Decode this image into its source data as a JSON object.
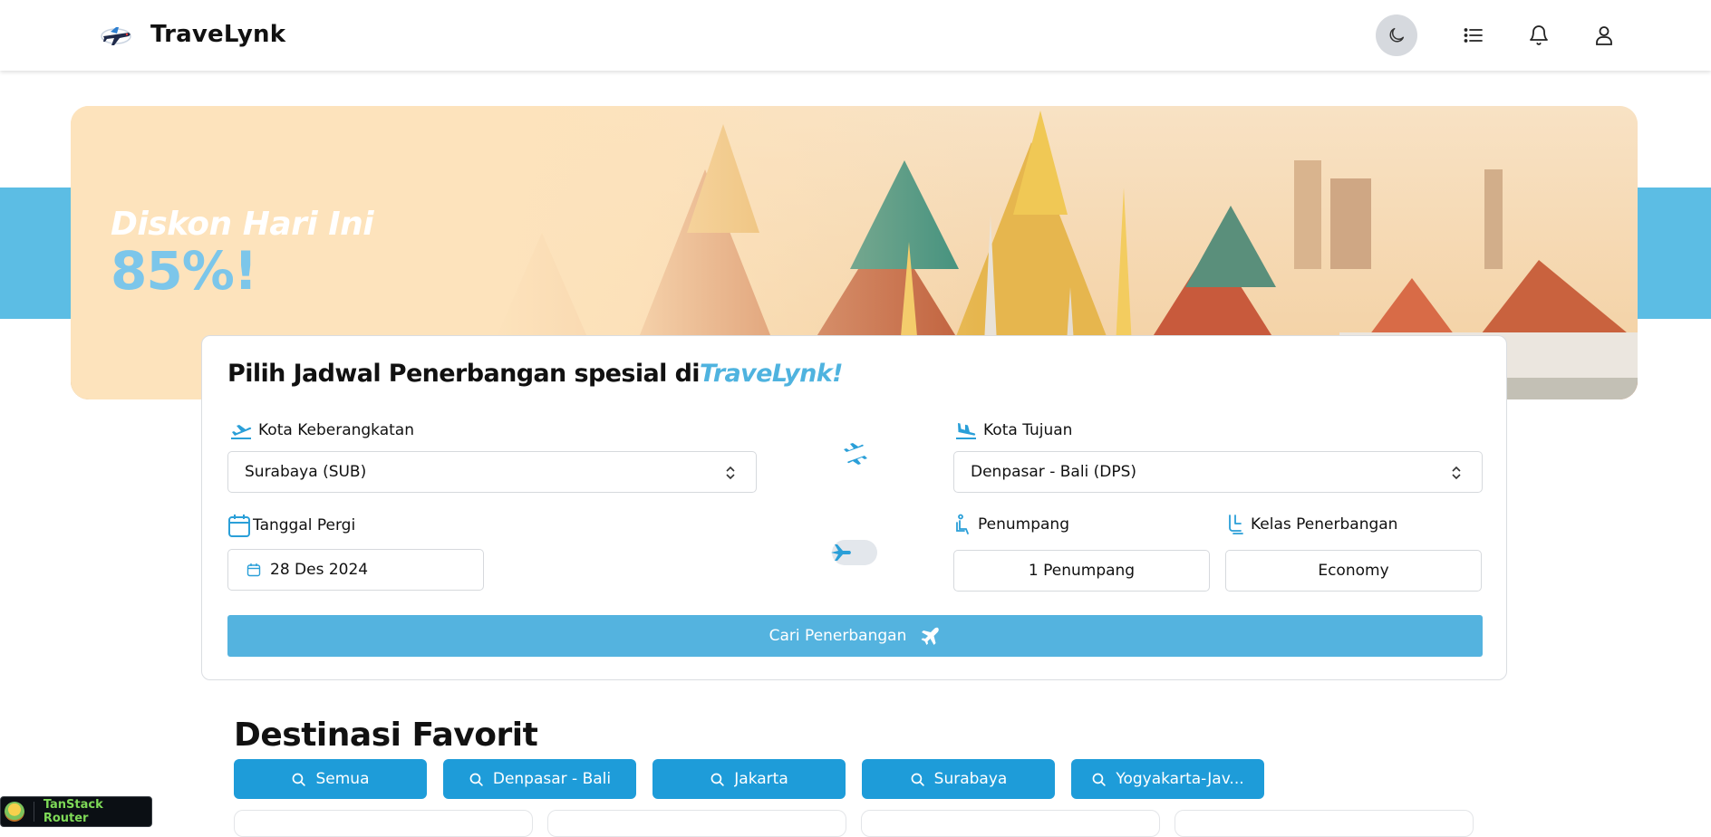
{
  "header": {
    "brand_name": "TraveLynk",
    "icons": [
      "plane-logo-icon",
      "moon-icon",
      "list-icon",
      "bell-icon",
      "user-icon"
    ]
  },
  "hero": {
    "promo_line1": "Diskon Hari Ini",
    "promo_line2": "85%!"
  },
  "search_card": {
    "title_prefix": "Pilih Jadwal Penerbangan spesial di",
    "title_brand": "TraveLynk!",
    "departure_label": "Kota Keberangkatan",
    "departure_value": "Surabaya (SUB)",
    "destination_label": "Kota Tujuan",
    "destination_value": "Denpasar - Bali (DPS)",
    "date_label": "Tanggal Pergi",
    "date_value": "28 Des 2024",
    "round_trip_toggle_on": false,
    "passenger_label": "Penumpang",
    "passenger_value": "1 Penumpang",
    "class_label": "Kelas Penerbangan",
    "class_value": "Economy",
    "search_button": "Cari Penerbangan"
  },
  "destinations": {
    "title": "Destinasi Favorit",
    "chips": [
      "Semua",
      "Denpasar - Bali",
      "Jakarta",
      "Surabaya",
      "Yogyakarta-Jav..."
    ]
  },
  "devtools": {
    "label": "TanStack Router"
  },
  "colors": {
    "accent": "#54b3df",
    "chip": "#1e9cd9",
    "band": "#5cbde4",
    "hero_bg": "#fde3bc",
    "promo_percent": "#7cc6ea"
  }
}
